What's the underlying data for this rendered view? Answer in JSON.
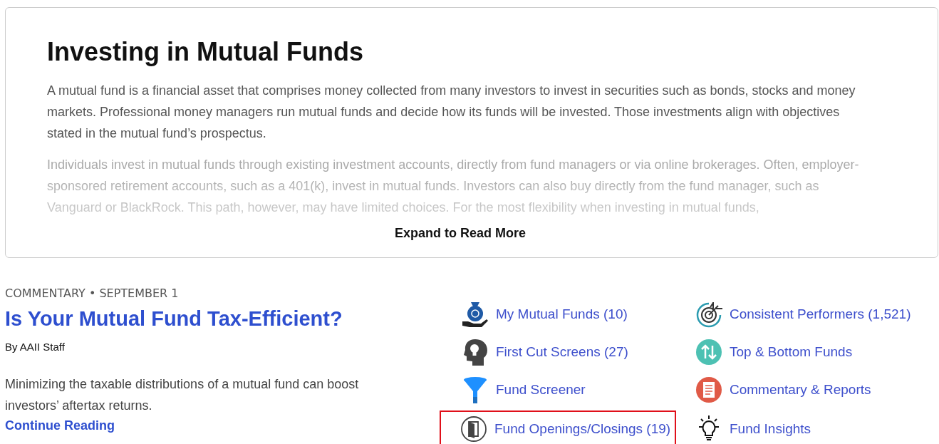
{
  "intro": {
    "title": "Investing in Mutual Funds",
    "paragraphs": [
      "A mutual fund is a financial asset that comprises money collected from many investors to invest in securities such as bonds, stocks and money markets. Professional money managers run mutual funds and decide how its funds will be invested. Those investments align with objectives stated in the mutual fund’s prospectus.",
      "Individuals invest in mutual funds through existing investment accounts, directly from fund managers or via online brokerages. Often, employer-sponsored retirement accounts, such as a 401(k), invest in mutual funds. Investors can also buy directly from the fund manager, such as Vanguard or BlackRock. This path, however, may have limited choices. For the most flexibility when investing in mutual funds,"
    ],
    "expand_label": "Expand to Read More"
  },
  "article": {
    "kicker": "COMMENTARY • SEPTEMBER 1",
    "title": "Is Your Mutual Fund Tax-Efficient?",
    "byline": "By AAII Staff",
    "summary": "Minimizing the taxable distributions of a mutual fund can boost investors’ aftertax returns.",
    "link": "Continue Reading"
  },
  "links": [
    {
      "label": "My Mutual Funds (10)",
      "kind": "moneybag",
      "highlighted": false
    },
    {
      "label": "Consistent Performers (1,521)",
      "kind": "target",
      "highlighted": false
    },
    {
      "label": "First Cut Screens (27)",
      "kind": "head",
      "highlighted": false
    },
    {
      "label": "Top & Bottom Funds",
      "kind": "updown",
      "highlighted": false
    },
    {
      "label": "Fund Screener",
      "kind": "funnel",
      "highlighted": false
    },
    {
      "label": "Commentary & Reports",
      "kind": "report",
      "highlighted": false
    },
    {
      "label": "Fund Openings/Closings (19)",
      "kind": "door",
      "highlighted": true
    },
    {
      "label": "Fund Insights",
      "kind": "bulb",
      "highlighted": false
    }
  ]
}
